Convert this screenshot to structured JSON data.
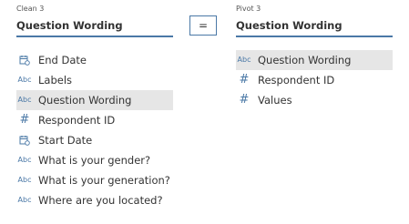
{
  "left": {
    "source": "Clean 3",
    "selected_field": "Question Wording",
    "fields": [
      {
        "type_icon": "calendar-icon",
        "label": "End Date"
      },
      {
        "type_icon": "abc-icon",
        "type_text": "Abc",
        "label": "Labels"
      },
      {
        "type_icon": "abc-icon",
        "type_text": "Abc",
        "label": "Question Wording",
        "selected": true
      },
      {
        "type_icon": "hash-icon",
        "type_text": "#",
        "label": "Respondent ID"
      },
      {
        "type_icon": "calendar-icon",
        "label": "Start Date"
      },
      {
        "type_icon": "abc-icon",
        "type_text": "Abc",
        "label": "What is your gender?"
      },
      {
        "type_icon": "abc-icon",
        "type_text": "Abc",
        "label": "What is your generation?"
      },
      {
        "type_icon": "abc-icon",
        "type_text": "Abc",
        "label": "Where are you located?"
      }
    ]
  },
  "operator": "=",
  "right": {
    "source": "Pivot 3",
    "selected_field": "Question Wording",
    "fields": [
      {
        "type_icon": "abc-icon",
        "type_text": "Abc",
        "label": "Question Wording",
        "selected": true
      },
      {
        "type_icon": "hash-icon",
        "type_text": "#",
        "label": "Respondent ID"
      },
      {
        "type_icon": "hash-icon",
        "type_text": "#",
        "label": "Values"
      }
    ]
  },
  "colors": {
    "accent": "#4a78a6",
    "selected_bg": "#e6e6e6"
  }
}
